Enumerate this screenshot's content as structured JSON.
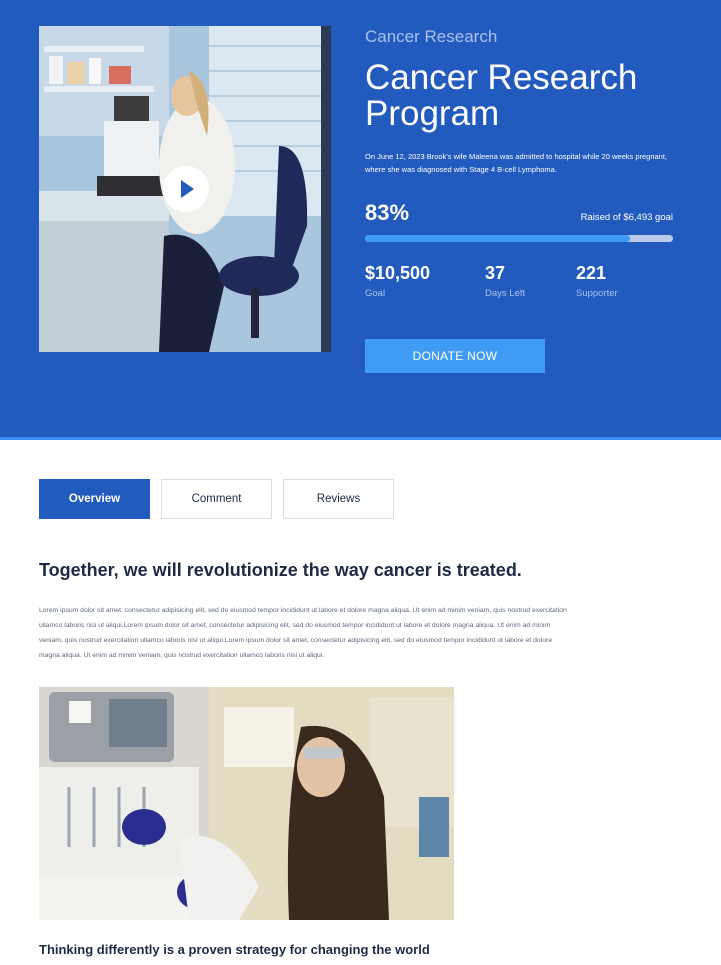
{
  "hero": {
    "eyebrow": "Cancer Research",
    "title": "Cancer Research Program",
    "description": "On June 12, 2023 Brook's wife Maleena was admitted to hospital while 20 weeks pregnant, where she was diagnosed with Stage 4 B-cell Lymphoma.",
    "percent_label": "83%",
    "progress_fraction": 0.86,
    "raised_text": "Raised of $6,493 goal",
    "stats": [
      {
        "value": "$10,500",
        "label": "Goal"
      },
      {
        "value": "37",
        "label": "Days Left"
      },
      {
        "value": "221",
        "label": "Supporter"
      }
    ],
    "donate_label": "DONATE NOW",
    "video_icon": "play-icon"
  },
  "tabs": [
    {
      "label": "Overview",
      "active": true
    },
    {
      "label": "Comment",
      "active": false
    },
    {
      "label": "Reviews",
      "active": false
    }
  ],
  "content": {
    "heading": "Together, we will revolutionize the way cancer is treated.",
    "paragraph": "Lorem ipsum dolor sit amet, consectetur adipisicing elit, sed do eiusmod tempor incididunt ut labore et dolore magna aliqua. Ut enim ad minim veniam, quis nostrud exercitation ullamco laboris nisi ut aliqui.Lorem ipsum dolor sit amet, consectetur adipisicing elit, sed do eiusmod tempor incididunt ut labore et dolore magna aliqua. Ut enim ad minim veniam, quis nostrud exercitation ullamco laboris nisi ut aliqui.Lorem ipsum dolor sit amet, consectetur adipisicing elit, sed do eiusmod tempor incididunt ut labore et dolore magna aliqua. Ut enim ad minim veniam, quis nostrud exercitation ullamco laboris nisi ut aliqui.",
    "subheading": "Thinking differently is a proven strategy for changing the world"
  },
  "colors": {
    "hero_bg": "#225bbd",
    "accent": "#3f9bf4",
    "heading": "#1c2b45"
  }
}
